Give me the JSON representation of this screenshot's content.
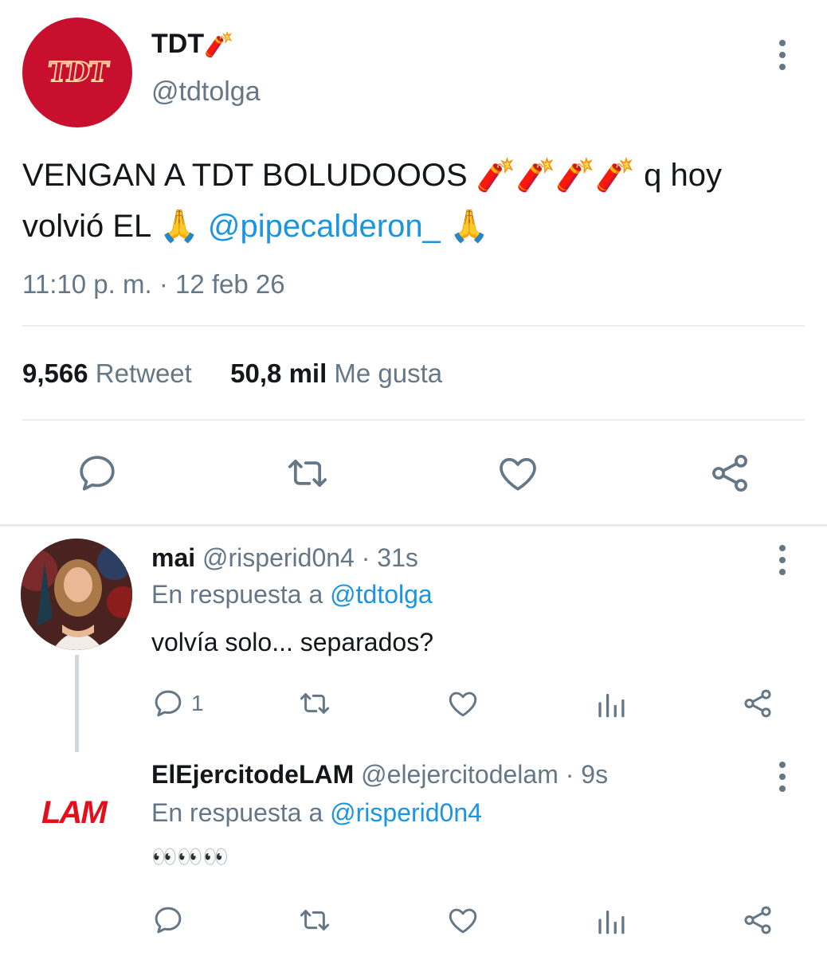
{
  "main_tweet": {
    "display_name": "TDT",
    "name_emoji": "🧨",
    "handle": "@tdtolga",
    "avatar_text": "TDT",
    "text_part1": "VENGAN A TDT BOLUDOOOS",
    "emojis_dynamite": "🧨🧨🧨🧨",
    "text_part2": "q hoy volvió EL",
    "emoji_pray": "🙏",
    "mention": "@pipecalderon_",
    "timestamp": "11:10 p. m. · 12 feb 26",
    "retweet_count": "9,566",
    "retweet_label": "Retweet",
    "like_count": "50,8 mil",
    "like_label": "Me gusta",
    "actions": [
      "reply-icon",
      "retweet-icon",
      "like-icon",
      "share-icon"
    ]
  },
  "replies": [
    {
      "display_name": "mai",
      "handle": "@risperid0n4",
      "time": "· 31s",
      "reply_to_label": "En respuesta a",
      "reply_to_handle": "@tdtolga",
      "text": "volvía solo... separados?",
      "reply_count": "1",
      "actions": [
        "reply-icon",
        "retweet-icon",
        "like-icon",
        "analytics-icon",
        "share-icon"
      ]
    },
    {
      "display_name": "ElEjercitodeLAM",
      "handle": "@elejercitodelam",
      "time": "· 9s",
      "reply_to_label": "En respuesta a",
      "reply_to_handle": "@risperid0n4",
      "text": "👀👀👀",
      "avatar_text": "LAM",
      "actions": [
        "reply-icon",
        "retweet-icon",
        "like-icon",
        "analytics-icon",
        "share-icon"
      ]
    }
  ],
  "colors": {
    "accent": "#1b95e0",
    "secondary_text": "#657786",
    "divider": "#e6ecf0",
    "avatar_red": "#c8102e",
    "lam_red": "#e3101b"
  }
}
